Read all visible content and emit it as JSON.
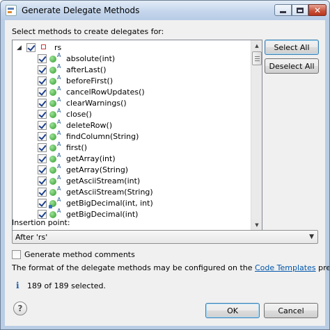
{
  "window": {
    "title": "Generate Delegate Methods",
    "minimize_icon": "minimize-icon",
    "maximize_icon": "maximize-icon",
    "close_icon": "close-icon"
  },
  "prompt": "Select methods to create delegates for:",
  "tree": {
    "root": {
      "label": "rs",
      "checked": true,
      "expanded": true
    },
    "methods": [
      {
        "label": "absolute(int)",
        "checked": true
      },
      {
        "label": "afterLast()",
        "checked": true
      },
      {
        "label": "beforeFirst()",
        "checked": true
      },
      {
        "label": "cancelRowUpdates()",
        "checked": true
      },
      {
        "label": "clearWarnings()",
        "checked": true
      },
      {
        "label": "close()",
        "checked": true
      },
      {
        "label": "deleteRow()",
        "checked": true
      },
      {
        "label": "findColumn(String)",
        "checked": true
      },
      {
        "label": "first()",
        "checked": true
      },
      {
        "label": "getArray(int)",
        "checked": true
      },
      {
        "label": "getArray(String)",
        "checked": true
      },
      {
        "label": "getAsciiStream(int)",
        "checked": true
      },
      {
        "label": "getAsciiStream(String)",
        "checked": true
      },
      {
        "label": "getBigDecimal(int, int)",
        "checked": true,
        "deprecated": true
      },
      {
        "label": "getBigDecimal(int)",
        "checked": true
      }
    ]
  },
  "buttons": {
    "select_all": "Select All",
    "deselect_all": "Deselect All",
    "ok": "OK",
    "cancel": "Cancel"
  },
  "insertion": {
    "label": "Insertion point:",
    "value": "After 'rs'"
  },
  "generate_comments": {
    "label": "Generate method comments",
    "checked": false
  },
  "info": {
    "before": "The format of the delegate methods may be configured on the ",
    "link": "Code Templates",
    "after": " preference page."
  },
  "status": "189 of 189 selected.",
  "colors": {
    "link": "#0055aa",
    "title_gradient_top": "#e3ecf7",
    "dialog_bg": "#f0f0f0"
  }
}
